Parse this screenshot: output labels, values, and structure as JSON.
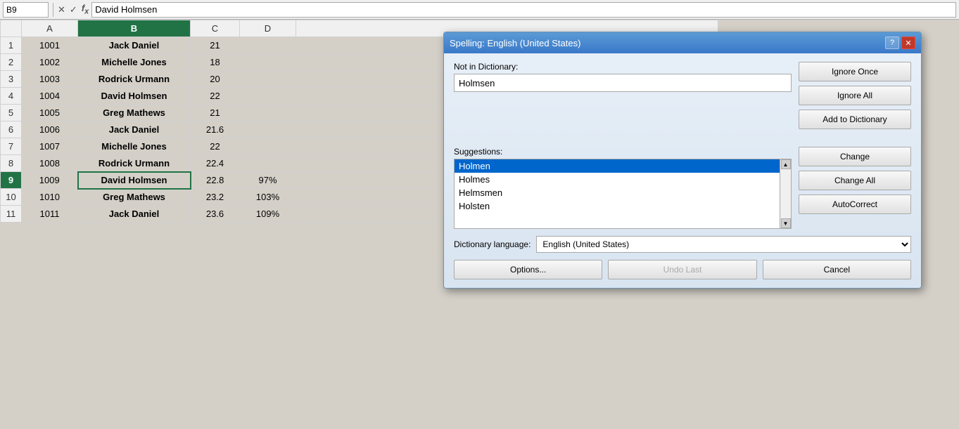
{
  "formulaBar": {
    "cellRef": "B9",
    "formula": "David Holmsen"
  },
  "grid": {
    "columns": [
      "",
      "A",
      "B",
      "C",
      "D"
    ],
    "rows": [
      {
        "num": 1,
        "a": "1001",
        "b": "Jack Daniel",
        "c": "21",
        "d": ""
      },
      {
        "num": 2,
        "a": "1002",
        "b": "Michelle Jones",
        "c": "18",
        "d": ""
      },
      {
        "num": 3,
        "a": "1003",
        "b": "Rodrick Urmann",
        "c": "20",
        "d": ""
      },
      {
        "num": 4,
        "a": "1004",
        "b": "David Holmsen",
        "c": "22",
        "d": ""
      },
      {
        "num": 5,
        "a": "1005",
        "b": "Greg Mathews",
        "c": "21",
        "d": ""
      },
      {
        "num": 6,
        "a": "1006",
        "b": "Jack Daniel",
        "c": "21.6",
        "d": ""
      },
      {
        "num": 7,
        "a": "1007",
        "b": "Michelle Jones",
        "c": "22",
        "d": ""
      },
      {
        "num": 8,
        "a": "1008",
        "b": "Rodrick Urmann",
        "c": "22.4",
        "d": ""
      },
      {
        "num": 9,
        "a": "1009",
        "b": "David Holmsen",
        "c": "22.8",
        "d": "97%"
      },
      {
        "num": 10,
        "a": "1010",
        "b": "Greg Mathews",
        "c": "23.2",
        "d": "103%"
      },
      {
        "num": 11,
        "a": "1011",
        "b": "Jack Daniel",
        "c": "23.6",
        "d": "109%"
      }
    ]
  },
  "dialog": {
    "title": "Spelling: English (United States)",
    "notInDictLabel": "Not in Dictionary:",
    "notInDictValue": "Holmsen",
    "suggestionsLabel": "Suggestions:",
    "suggestions": [
      {
        "text": "Holmen",
        "selected": true
      },
      {
        "text": "Holmes",
        "selected": false
      },
      {
        "text": "Helmsmen",
        "selected": false
      },
      {
        "text": "Holsten",
        "selected": false
      }
    ],
    "dictLangLabel": "Dictionary language:",
    "dictLangValue": "English (United States)",
    "buttons": {
      "ignoreOnce": "Ignore Once",
      "ignoreAll": "Ignore All",
      "addToDictionary": "Add to Dictionary",
      "change": "Change",
      "changeAll": "Change All",
      "autoCorrect": "AutoCorrect",
      "options": "Options...",
      "undoLast": "Undo Last",
      "cancel": "Cancel"
    }
  }
}
